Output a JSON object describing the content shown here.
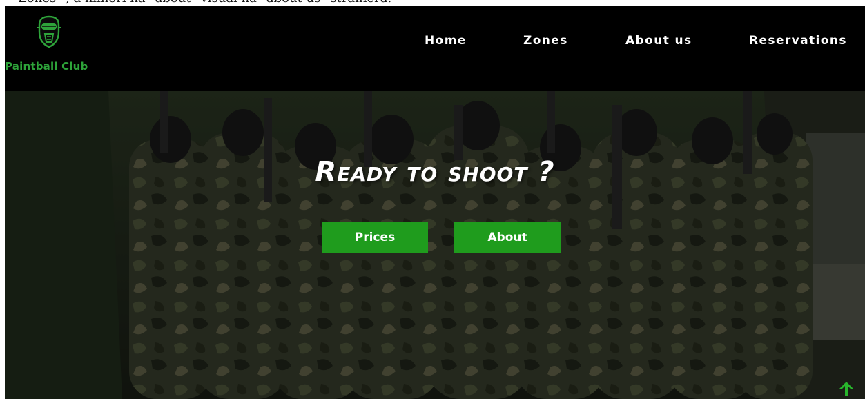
{
  "top_strip": {
    "text": "\"Zones\" , a minori ha \"about\" visual ha \"about us\" strainera."
  },
  "brand": {
    "name": "Paintball Club",
    "icon": "paintball-mask-icon",
    "color": "#2ea43a"
  },
  "nav": {
    "items": [
      {
        "label": "Home"
      },
      {
        "label": "Zones"
      },
      {
        "label": "About us"
      },
      {
        "label": "Reservations"
      }
    ]
  },
  "hero": {
    "title": "Ready to shoot ?",
    "buttons": {
      "prices_label": "Prices",
      "about_label": "About"
    },
    "button_color": "#1f9c1d"
  },
  "scroll_top": {
    "icon": "arrow-up-icon",
    "color": "#28b52c"
  }
}
